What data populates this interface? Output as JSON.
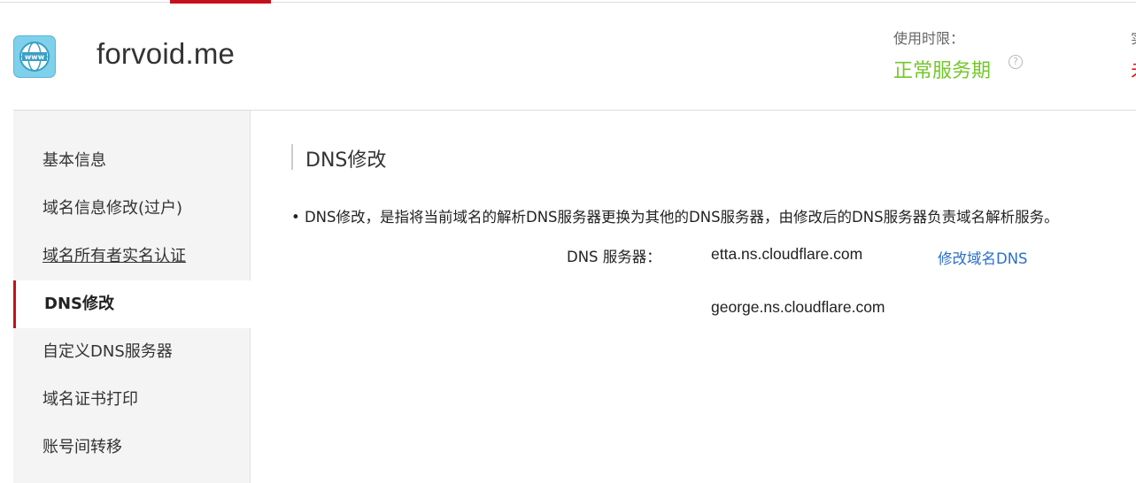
{
  "header": {
    "domain": "forvoid.me",
    "period_label": "使用时限：",
    "period_value": "正常服务期",
    "clipped_right_top": "实",
    "clipped_right_value": "未"
  },
  "sidebar": {
    "items": [
      {
        "label": "基本信息"
      },
      {
        "label": "域名信息修改(过户)"
      },
      {
        "label": "域名所有者实名认证"
      },
      {
        "label": "DNS修改"
      },
      {
        "label": "自定义DNS服务器"
      },
      {
        "label": "域名证书打印"
      },
      {
        "label": "账号间转移"
      }
    ],
    "active_index": 3
  },
  "main": {
    "title": "DNS修改",
    "description": "• DNS修改，是指将当前域名的解析DNS服务器更换为其他的DNS服务器，由修改后的DNS服务器负责域名解析服务。",
    "dns_label": "DNS 服务器：",
    "dns_servers": [
      "etta.ns.cloudflare.com",
      "george.ns.cloudflare.com"
    ],
    "modify_link": "修改域名DNS"
  },
  "colors": {
    "accent_red": "#c5111b",
    "status_green": "#74c72b",
    "link_blue": "#2a6fc9"
  },
  "icons": {
    "logo": "www-globe-icon",
    "help": "question-circle-icon"
  }
}
